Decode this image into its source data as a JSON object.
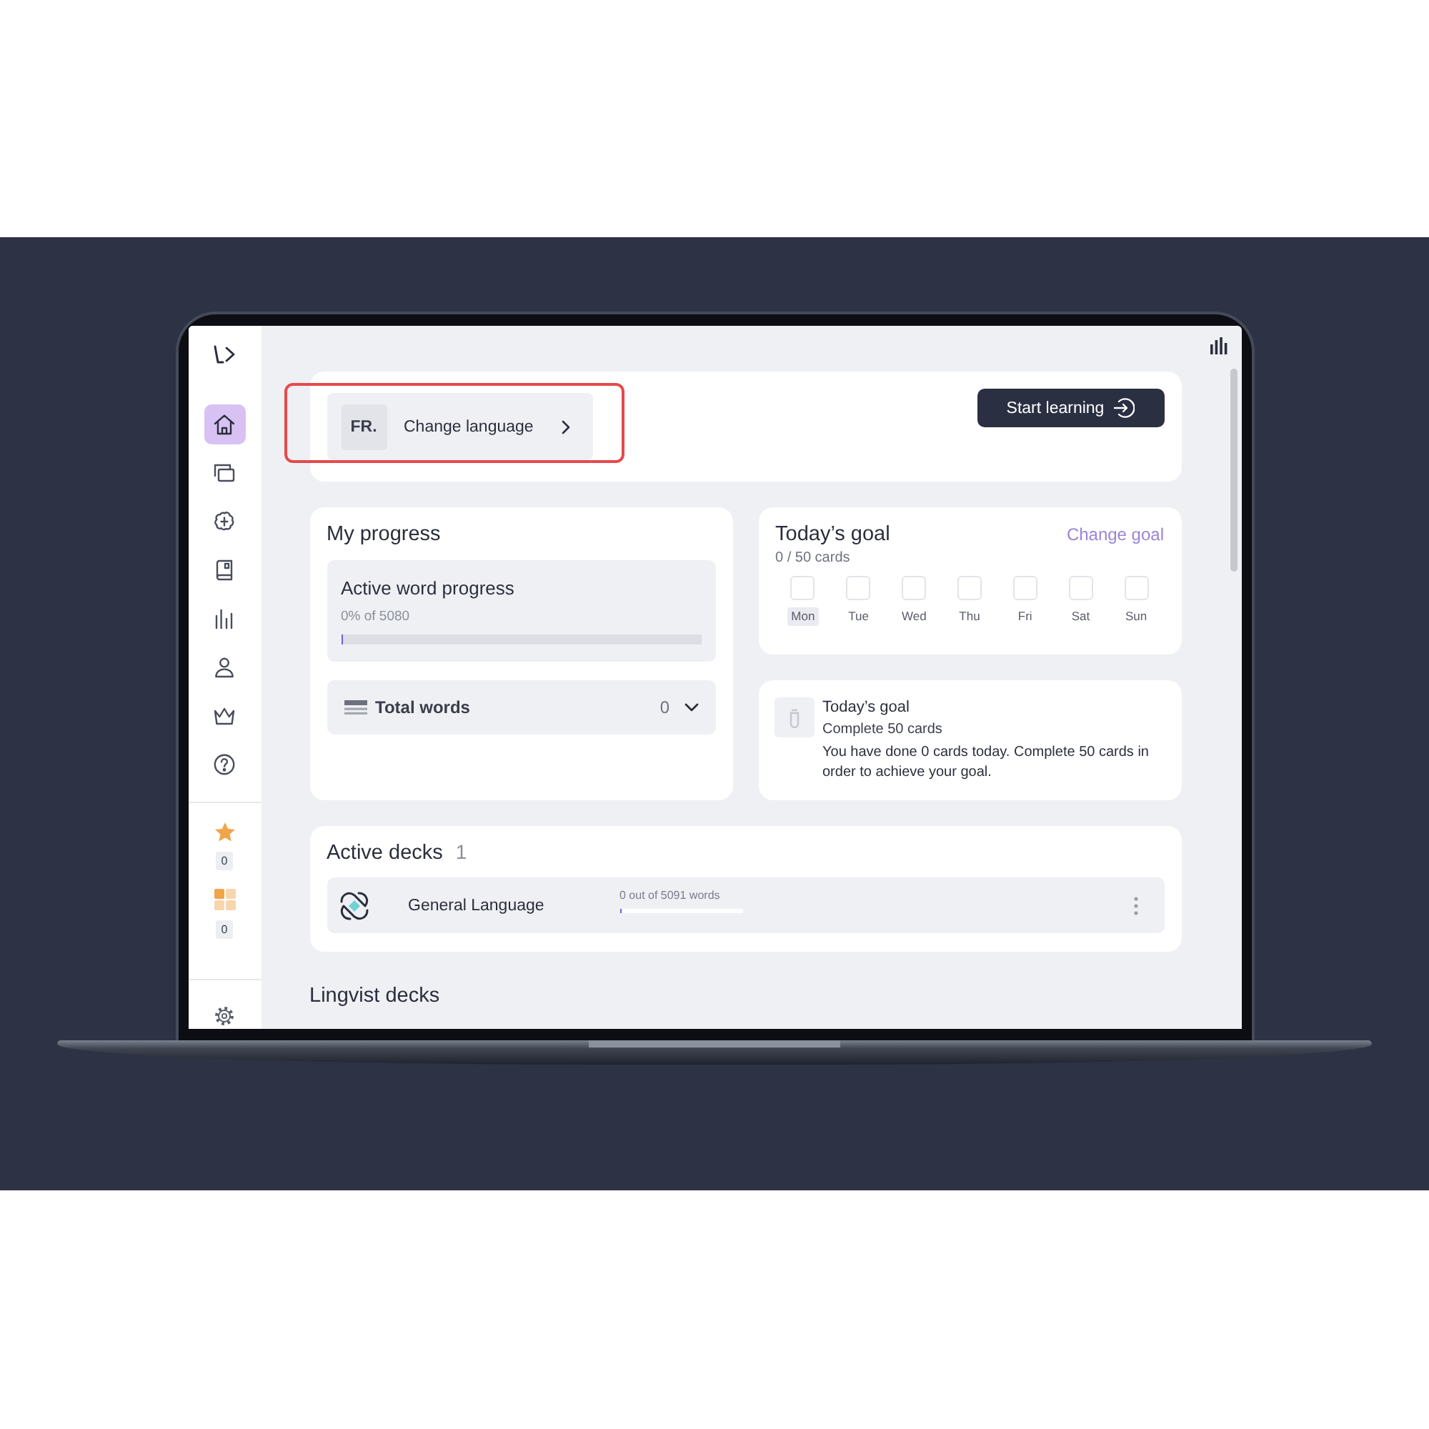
{
  "sidebar": {
    "nav": [
      {
        "selected": true
      },
      {
        "selected": false
      },
      {
        "selected": false
      },
      {
        "selected": false
      },
      {
        "selected": false
      },
      {
        "selected": false
      },
      {
        "selected": false
      },
      {
        "selected": false
      }
    ],
    "counters": [
      {
        "count": "0"
      },
      {
        "count": "0"
      }
    ]
  },
  "top_card": {
    "language_button": {
      "code": "FR.",
      "label": "Change language",
      "highlighted": true
    },
    "start_button": {
      "label": "Start learning"
    }
  },
  "my_progress": {
    "title": "My progress",
    "active_word_progress": {
      "title": "Active word progress",
      "caption": "0% of 5080",
      "level": 0
    },
    "total_words": {
      "label": "Total words",
      "value": "0",
      "expanded": false
    }
  },
  "todays_goal": {
    "title": "Today’s goal",
    "link": "Change goal",
    "count": "0 / 50 cards",
    "days": [
      {
        "label": "Mon",
        "selected": true,
        "checked": false
      },
      {
        "label": "Tue",
        "selected": false,
        "checked": false
      },
      {
        "label": "Wed",
        "selected": false,
        "checked": false
      },
      {
        "label": "Thu",
        "selected": false,
        "checked": false
      },
      {
        "label": "Fri",
        "selected": false,
        "checked": false
      },
      {
        "label": "Sat",
        "selected": false,
        "checked": false
      },
      {
        "label": "Sun",
        "selected": false,
        "checked": false
      }
    ]
  },
  "goal_info": {
    "title": "Today’s goal",
    "subtitle": "Complete 50 cards",
    "text": "You have done 0 cards today. Complete 50 cards in order to achieve your goal."
  },
  "active_decks": {
    "title": "Active decks",
    "count": "1",
    "decks": [
      {
        "name": "General Language",
        "progress": "0 out of 5091 words",
        "level": 0
      }
    ]
  },
  "lingvist_decks": {
    "title": "Lingvist decks"
  }
}
